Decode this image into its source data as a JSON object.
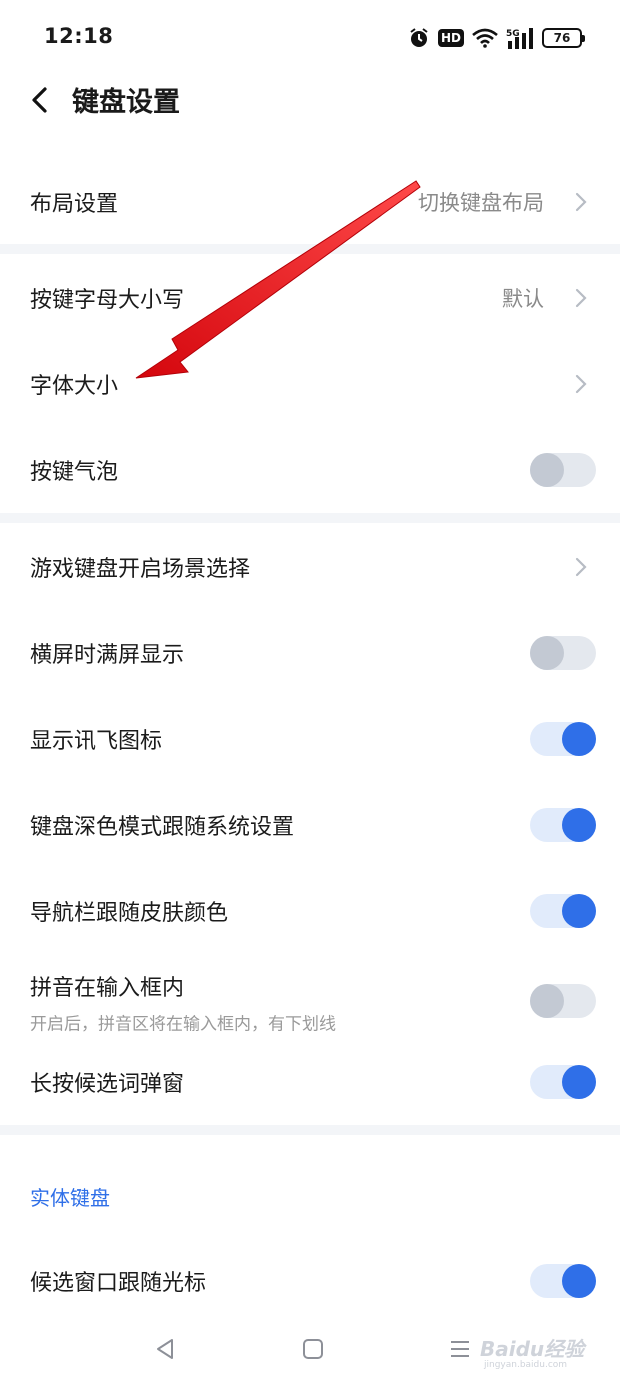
{
  "status": {
    "time": "12:18",
    "hd": "HD",
    "network": "5G",
    "battery": "76"
  },
  "header": {
    "title": "键盘设置"
  },
  "rows": {
    "layout": {
      "label": "布局设置",
      "value": "切换键盘布局"
    },
    "letter_case": {
      "label": "按键字母大小写",
      "value": "默认"
    },
    "font_size": {
      "label": "字体大小"
    },
    "key_bubble": {
      "label": "按键气泡",
      "enabled": false
    },
    "game_keyboard": {
      "label": "游戏键盘开启场景选择"
    },
    "landscape_full": {
      "label": "横屏时满屏显示",
      "enabled": false
    },
    "show_xunfei_icon": {
      "label": "显示讯飞图标",
      "enabled": true
    },
    "dark_mode_follow": {
      "label": "键盘深色模式跟随系统设置",
      "enabled": true
    },
    "navbar_follow_skin": {
      "label": "导航栏跟随皮肤颜色",
      "enabled": true
    },
    "pinyin_inline": {
      "label": "拼音在输入框内",
      "sub": "开启后，拼音区将在输入框内，有下划线",
      "enabled": false
    },
    "long_press_popup": {
      "label": "长按候选词弹窗",
      "enabled": true
    },
    "candidate_follow_cursor": {
      "label": "候选窗口跟随光标",
      "enabled": true
    }
  },
  "section": {
    "physical_keyboard": "实体键盘"
  },
  "watermark": {
    "text": "Baidu经验",
    "sub": "jingyan.baidu.com"
  },
  "colors": {
    "accent": "#2f6fe8",
    "annotation_arrow": "#e8141b"
  }
}
